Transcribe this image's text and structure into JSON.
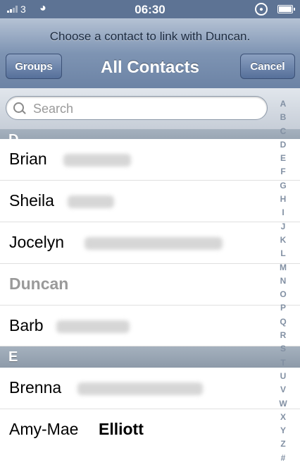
{
  "status_bar": {
    "carrier": "3",
    "time": "06:30",
    "lock_icon": "rotation-lock-icon"
  },
  "nav": {
    "prompt": "Choose a contact to link with Duncan.",
    "title": "All Contacts",
    "groups_label": "Groups",
    "cancel_label": "Cancel"
  },
  "search": {
    "placeholder": "Search"
  },
  "sections": [
    {
      "letter": "D",
      "contacts": [
        {
          "first": "Brian",
          "last": ""
        },
        {
          "first": "Sheila",
          "last": ""
        },
        {
          "first": "Jocelyn",
          "last": ""
        },
        {
          "first": "Duncan",
          "last": "",
          "disabled": true
        },
        {
          "first": "Barb",
          "last": ""
        }
      ]
    },
    {
      "letter": "E",
      "contacts": [
        {
          "first": "Brenna",
          "last": ""
        },
        {
          "first": "Amy-Mae",
          "last": "Elliott"
        }
      ]
    }
  ],
  "index": [
    "A",
    "B",
    "C",
    "D",
    "E",
    "F",
    "G",
    "H",
    "I",
    "J",
    "K",
    "L",
    "M",
    "N",
    "O",
    "P",
    "Q",
    "R",
    "S",
    "T",
    "U",
    "V",
    "W",
    "X",
    "Y",
    "Z",
    "#"
  ]
}
